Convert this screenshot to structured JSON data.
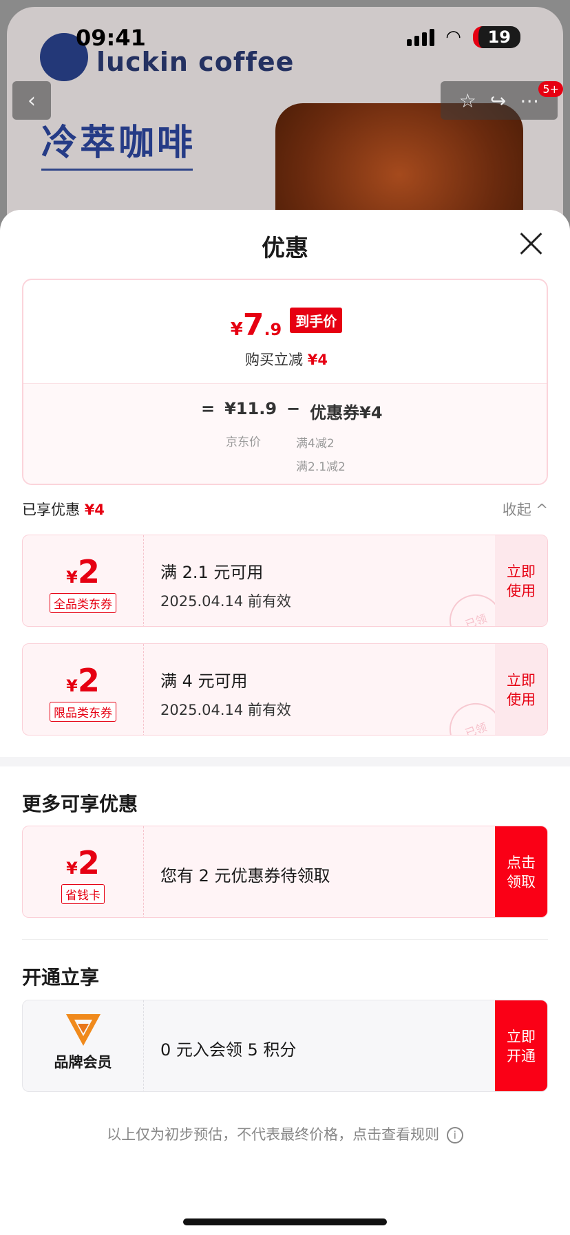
{
  "background": {
    "brand": "luckin coffee",
    "product_title": "冷萃咖啡",
    "badge": "5+"
  },
  "status_bar": {
    "time": "09:41",
    "battery": "19"
  },
  "sheet": {
    "title": "优惠"
  },
  "price_card": {
    "yen": "¥",
    "price_int": "7",
    "price_dec": ".9",
    "final_tag": "到手价",
    "instant_label": "购买立减",
    "instant_value": "¥4",
    "eq": "=",
    "jd_price": "¥11.9",
    "minus": "−",
    "coupon_total": "优惠券¥4",
    "jd_price_label": "京东价",
    "rule1": "满4减2",
    "rule2": "满2.1减2"
  },
  "enjoyed": {
    "label": "已享优惠",
    "value": "¥4",
    "collapse": "收起 ^"
  },
  "coupons": [
    {
      "yen": "¥",
      "amount": "2",
      "type": "全品类东券",
      "condition": "满 2.1 元可用",
      "valid": "2025.04.14 前有效",
      "action": "立即使用",
      "stamp": "已领"
    },
    {
      "yen": "¥",
      "amount": "2",
      "type": "限品类东券",
      "condition": "满 4 元可用",
      "valid": "2025.04.14 前有效",
      "action": "立即使用",
      "stamp": "已领"
    }
  ],
  "more": {
    "title": "更多可享优惠",
    "card": {
      "yen": "¥",
      "amount": "2",
      "type": "省钱卡",
      "text": "您有 2 元优惠券待领取",
      "action": "点击领取"
    }
  },
  "open": {
    "title": "开通立享",
    "card": {
      "label": "品牌会员",
      "text": "0 元入会领 5 积分",
      "action": "立即开通"
    }
  },
  "footer": {
    "note": "以上仅为初步预估，不代表最终价格，点击查看规则"
  },
  "colors": {
    "accent": "#e60012",
    "tint": "#fff4f6"
  }
}
